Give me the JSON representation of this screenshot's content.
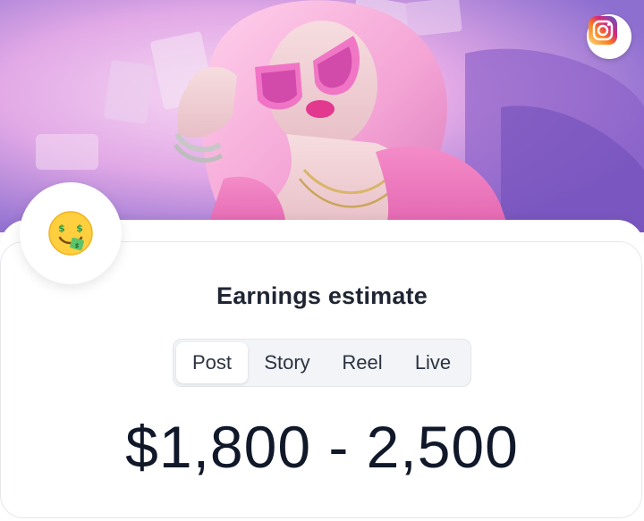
{
  "hero": {
    "image_icon": "glamour-portrait-illustration",
    "social_icon": "instagram-icon",
    "colors": {
      "instagram_start": "#feda75",
      "instagram_mid": "#d62976",
      "instagram_end": "#4f5bd5"
    }
  },
  "card": {
    "emoji_icon": "money-mouth-face-icon",
    "title": "Earnings estimate",
    "tabs": [
      {
        "label": "Post",
        "active": true
      },
      {
        "label": "Story",
        "active": false
      },
      {
        "label": "Reel",
        "active": false
      },
      {
        "label": "Live",
        "active": false
      }
    ],
    "amount": "$1,800 - 2,500"
  }
}
